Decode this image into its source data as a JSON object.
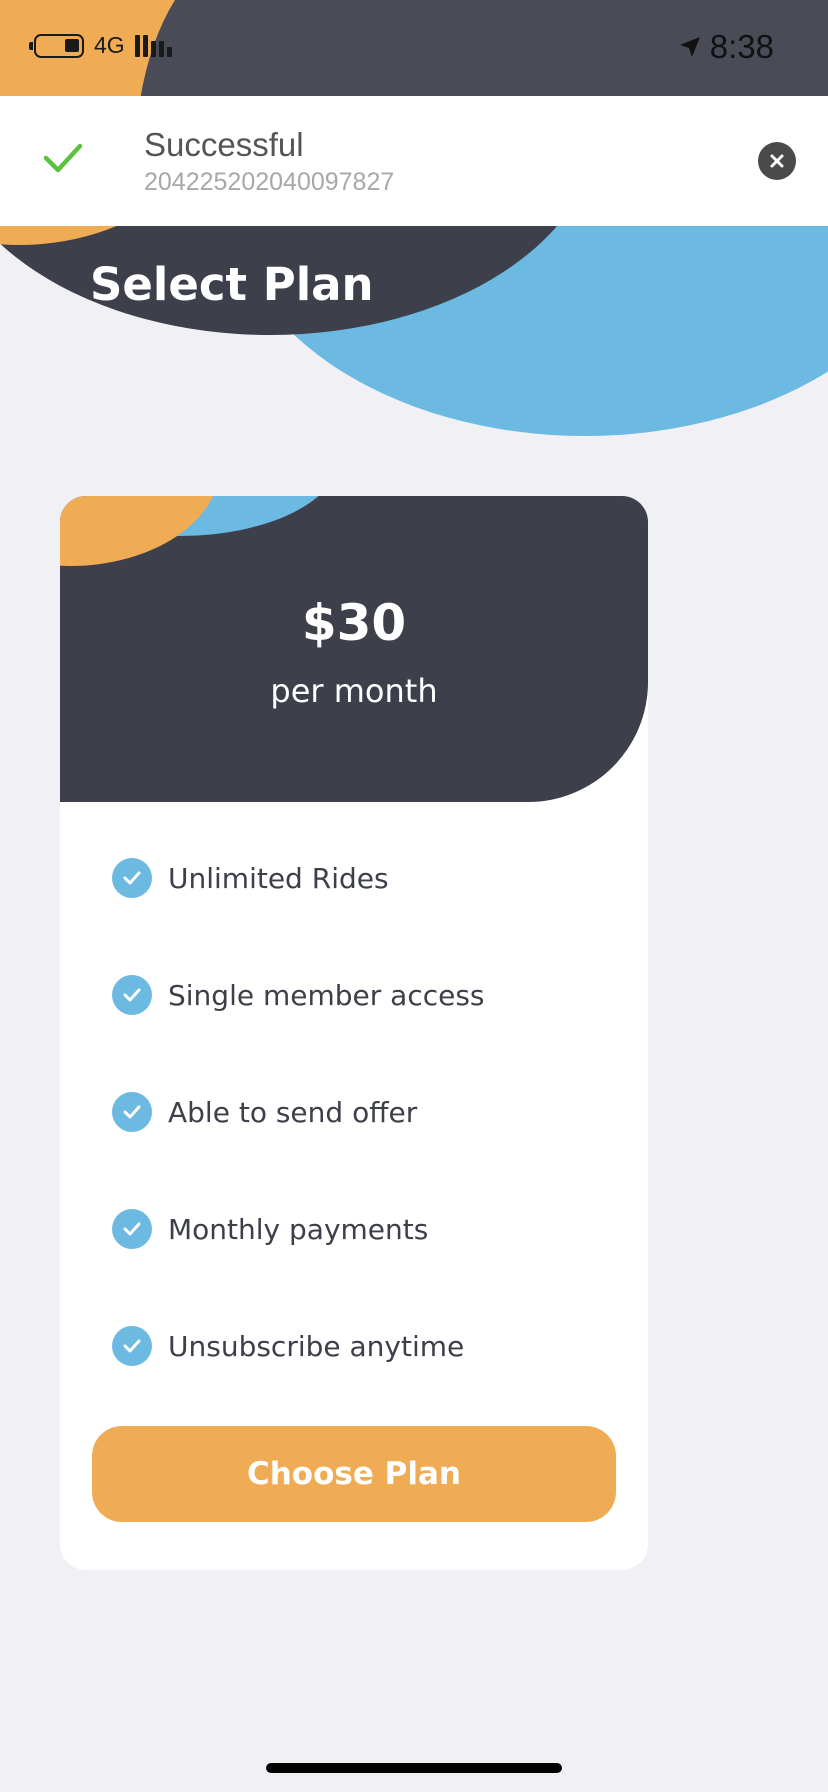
{
  "status_bar": {
    "network": "4G",
    "time": "8:38"
  },
  "toast": {
    "title": "Successful",
    "reference": "204225202040097827"
  },
  "page": {
    "title": "Select Plan"
  },
  "plan": {
    "price": "$30",
    "period": "per month",
    "features": [
      {
        "label": "Unlimited Rides"
      },
      {
        "label": "Single member access"
      },
      {
        "label": "Able to send offer"
      },
      {
        "label": "Monthly payments"
      },
      {
        "label": "Unsubscribe anytime"
      }
    ],
    "cta_label": "Choose Plan"
  },
  "colors": {
    "accent_orange": "#f0ac55",
    "accent_blue": "#6cb9e2",
    "dark": "#3d3f4b",
    "background": "#f0f0f5",
    "success_green": "#5cc23d"
  }
}
